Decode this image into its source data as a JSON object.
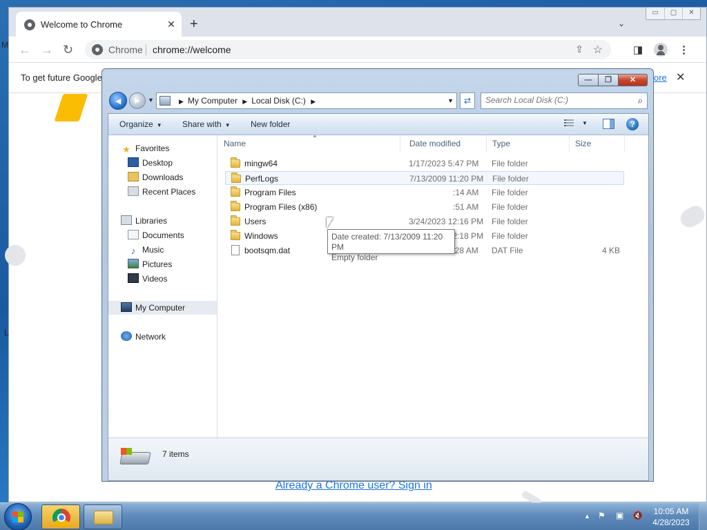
{
  "chrome": {
    "tab_title": "Welcome to Chrome",
    "tab_close": "✕",
    "new_tab": "+",
    "tab_search": "⌄",
    "window_buttons": {
      "min": "▭",
      "max": "▢",
      "close": "✕"
    },
    "nav": {
      "back": "←",
      "forward": "→",
      "reload": "↻"
    },
    "omnibox": {
      "site": "Chrome",
      "url": "chrome://welcome"
    },
    "toolbar_icons": {
      "share": "⇪",
      "bookmark": "☆",
      "side_panel": "◨",
      "menu": "⋮"
    },
    "infobar": {
      "text": "To get future Google",
      "link_fragment": "ore",
      "close": "✕"
    },
    "signin_link": "Already a Chrome user? Sign in",
    "left_edge_text_1": "M",
    "left_edge_text_2": "L"
  },
  "explorer": {
    "caption_buttons": {
      "min": "—",
      "max": "❐",
      "close": "✕"
    },
    "nav": {
      "back": "◄",
      "forward": "►"
    },
    "breadcrumb": [
      "My Computer",
      "Local Disk (C:)"
    ],
    "search_placeholder": "Search Local Disk (C:)",
    "commands": {
      "organize": "Organize",
      "share_with": "Share with",
      "new_folder": "New folder"
    },
    "help": "?",
    "sidebar": {
      "favorites_header": "Favorites",
      "favorites": [
        "Desktop",
        "Downloads",
        "Recent Places"
      ],
      "libraries_header": "Libraries",
      "libraries": [
        "Documents",
        "Music",
        "Pictures",
        "Videos"
      ],
      "computer": "My Computer",
      "network": "Network"
    },
    "columns": {
      "name": "Name",
      "date": "Date modified",
      "type": "Type",
      "size": "Size"
    },
    "files": [
      {
        "name": "mingw64",
        "date": "1/17/2023 5:47 PM",
        "type": "File folder",
        "size": "",
        "kind": "folder"
      },
      {
        "name": "PerfLogs",
        "date": "7/13/2009 11:20 PM",
        "type": "File folder",
        "size": "",
        "kind": "folder"
      },
      {
        "name": "Program Files",
        "date": ":14 AM",
        "type": "File folder",
        "size": "",
        "kind": "folder"
      },
      {
        "name": "Program Files (x86)",
        "date": ":51 AM",
        "type": "File folder",
        "size": "",
        "kind": "folder"
      },
      {
        "name": "Users",
        "date": "3/24/2023 12:16 PM",
        "type": "File folder",
        "size": "",
        "kind": "folder"
      },
      {
        "name": "Windows",
        "date": "3/24/2023 12:18 PM",
        "type": "File folder",
        "size": "",
        "kind": "folder"
      },
      {
        "name": "bootsqm.dat",
        "date": "3/25/2023 2:28 AM",
        "type": "DAT File",
        "size": "4 KB",
        "kind": "file"
      }
    ],
    "tooltip": {
      "line1": "Date created: 7/13/2009 11:20 PM",
      "line2": "Empty folder"
    },
    "status": "7 items"
  },
  "taskbar": {
    "clock_time": "10:05 AM",
    "clock_date": "4/28/2023",
    "tray_icons": [
      "tray-arrow-icon",
      "action-center-icon",
      "network-icon",
      "volume-muted-icon"
    ]
  }
}
